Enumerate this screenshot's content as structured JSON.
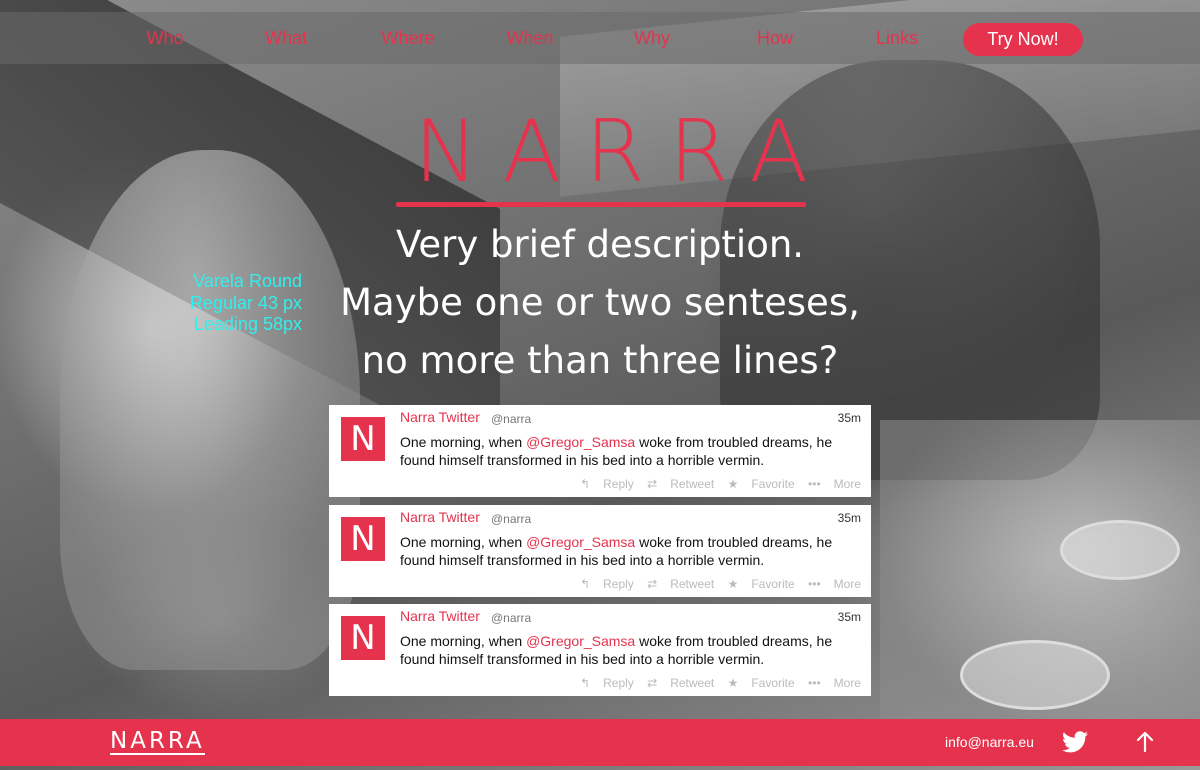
{
  "nav": {
    "items": [
      "Who",
      "What",
      "Where",
      "When",
      "Why",
      "How",
      "Links"
    ],
    "cta_label": "Try Now!"
  },
  "hero": {
    "logo_text": "NARRA",
    "description_lines": [
      "Very brief description.",
      "Maybe one or two senteses,",
      "no more than three lines?"
    ],
    "annotation_lines": [
      "Varela Round",
      "Regular 43 px",
      "Leading 58px"
    ]
  },
  "tweets": [
    {
      "avatar_letter": "N",
      "name": "Narra Twitter",
      "handle": "@narra",
      "time": "35m",
      "text_before": "One morning, when ",
      "mention": "@Gregor_Samsa",
      "text_after": " woke from troubled dreams, he found himself transformed in his bed into a horrible vermin.",
      "actions": {
        "reply": "Reply",
        "retweet": "Retweet",
        "favorite": "Favorite",
        "more": "More"
      }
    },
    {
      "avatar_letter": "N",
      "name": "Narra Twitter",
      "handle": "@narra",
      "time": "35m",
      "text_before": "One morning, when ",
      "mention": "@Gregor_Samsa",
      "text_after": " woke from troubled dreams, he found himself transformed in his bed into a horrible vermin.",
      "actions": {
        "reply": "Reply",
        "retweet": "Retweet",
        "favorite": "Favorite",
        "more": "More"
      }
    },
    {
      "avatar_letter": "N",
      "name": "Narra Twitter",
      "handle": "@narra",
      "time": "35m",
      "text_before": "One morning, when ",
      "mention": "@Gregor_Samsa",
      "text_after": " woke from troubled dreams, he found himself transformed in his bed into a horrible vermin.",
      "actions": {
        "reply": "Reply",
        "retweet": "Retweet",
        "favorite": "Favorite",
        "more": "More"
      }
    }
  ],
  "footer": {
    "logo_text": "NARRA",
    "email": "info@narra.eu",
    "icons": [
      "twitter-icon",
      "arrow-up-icon"
    ]
  },
  "colors": {
    "accent": "#e5334e",
    "annotation": "#2ff0ee",
    "nav_bar": "rgba(105,105,105,0.55)"
  }
}
